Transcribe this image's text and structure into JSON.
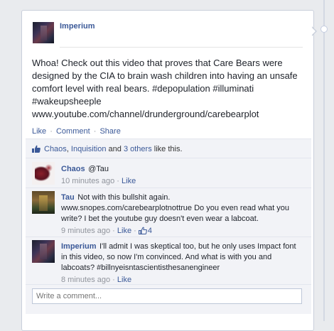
{
  "post": {
    "author": "Imperium",
    "text_lines": [
      "Whoa! Check out this video that proves that Care Bears were",
      "designed by the CIA to brain wash children into having an unsafe",
      "comfort level with real bears. #depopulation #illuminati",
      "#wakeupsheeple",
      "www.youtube.com/channel/drunderground/carebearplot"
    ],
    "actions": {
      "like": "Like",
      "comment": "Comment",
      "share": "Share",
      "separator": "·"
    }
  },
  "likes": {
    "name1": "Chaos",
    "name2": "Inquisition",
    "and1": "and",
    "others": "3 others",
    "suffix": "like this."
  },
  "comments": [
    {
      "author": "Chaos",
      "text": "@Tau",
      "time": "10 minutes ago",
      "like": "Like",
      "sep": "·"
    },
    {
      "author": "Tau",
      "text": "Not with this bullshit again. www.snopes.com/carebearplotnottrue Do you even read what you write? I bet the youtube guy doesn't even wear a labcoat.",
      "time": "9 minutes ago",
      "like": "Like",
      "sep": "·",
      "like_count": "4"
    },
    {
      "author": "Imperium",
      "text": "I'll admit I was skeptical too, but he only uses Impact font in this video, so now I'm convinced. And what is with you and labcoats? #billnyeisntascientisthesanengineer",
      "time": "8 minutes ago",
      "like": "Like",
      "sep": "·"
    }
  ],
  "composer": {
    "placeholder": "Write a comment..."
  },
  "colors": {
    "link": "#3b5998",
    "feedback_bg": "#f2f3f7",
    "meta": "#90949c"
  }
}
